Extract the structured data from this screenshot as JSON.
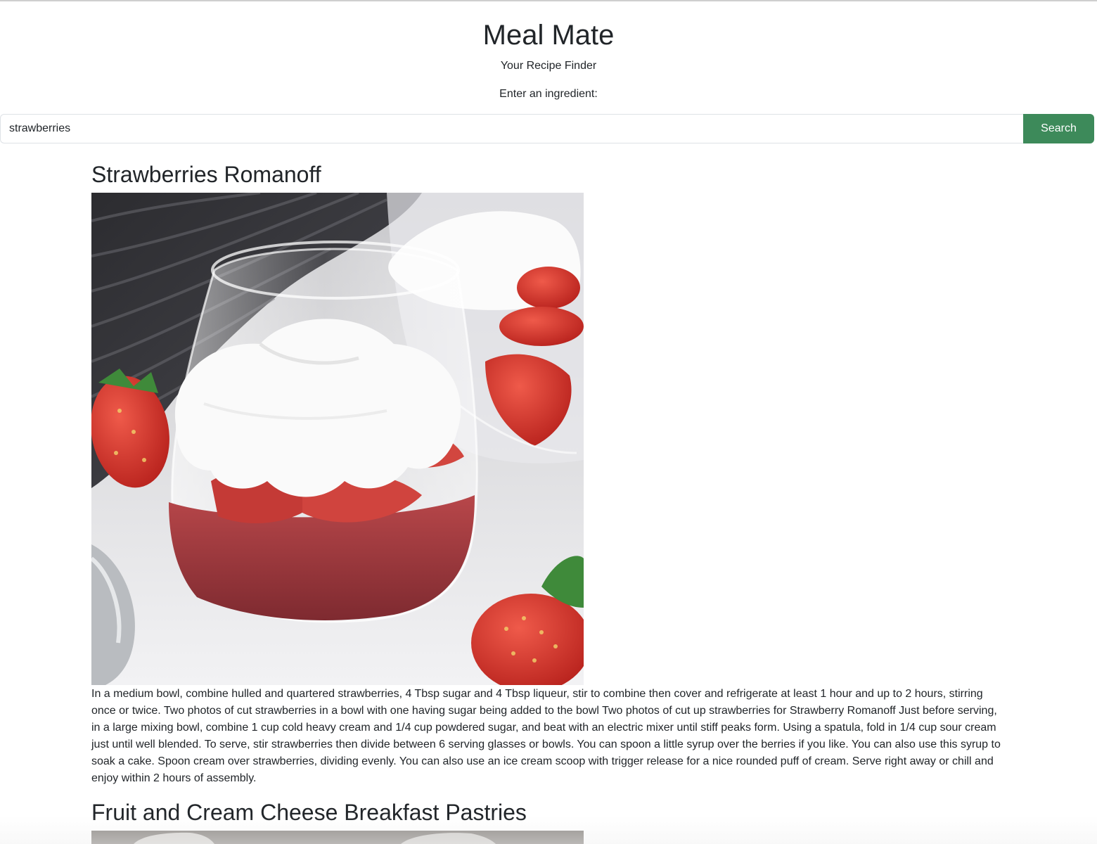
{
  "header": {
    "title": "Meal Mate",
    "subtitle": "Your Recipe Finder"
  },
  "search": {
    "label": "Enter an ingredient:",
    "value": "strawberries",
    "button_label": "Search"
  },
  "colors": {
    "search_button": "#3d8a5a",
    "text": "#212529"
  },
  "results": [
    {
      "title": "Strawberries Romanoff",
      "description": "In a medium bowl, combine hulled and quartered strawberries, 4 Tbsp sugar and 4 Tbsp liqueur, stir to combine then cover and refrigerate at least 1 hour and up to 2 hours, stirring once or twice. Two photos of cut strawberries in a bowl with one having sugar being added to the bowl Two photos of cut up strawberries for Strawberry Romanoff Just before serving, in a large mixing bowl, combine 1 cup cold heavy cream and 1/4 cup powdered sugar, and beat with an electric mixer until stiff peaks form. Using a spatula, fold in 1/4 cup sour cream just until well blended. To serve, stir strawberries then divide between 6 serving glasses or bowls. You can spoon a little syrup over the berries if you like. You can also use this syrup to soak a cake. Spoon cream over strawberries, dividing evenly. You can also use an ice cream scoop with trigger release for a nice rounded puff of cream. Serve right away or chill and enjoy within 2 hours of assembly."
    },
    {
      "title": "Fruit and Cream Cheese Breakfast Pastries"
    }
  ]
}
